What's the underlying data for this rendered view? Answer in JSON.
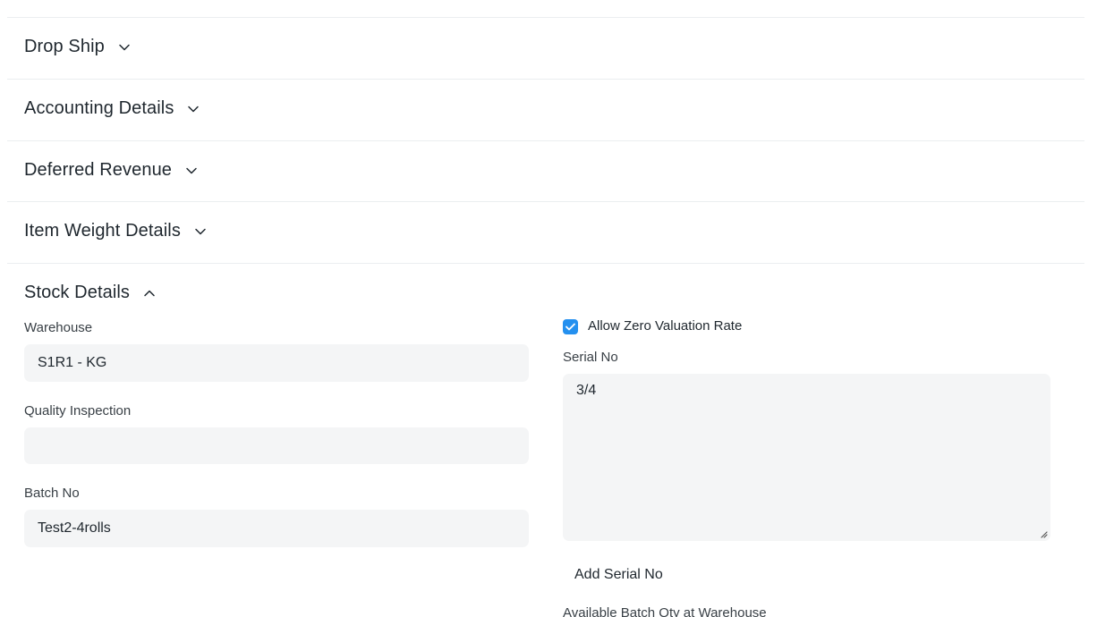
{
  "sections": {
    "drop_ship": "Drop Ship",
    "accounting_details": "Accounting Details",
    "deferred_revenue": "Deferred Revenue",
    "item_weight_details": "Item Weight Details",
    "stock_details": "Stock Details"
  },
  "stock": {
    "warehouse_label": "Warehouse",
    "warehouse_value": "S1R1 - KG",
    "quality_inspection_label": "Quality Inspection",
    "quality_inspection_value": "",
    "batch_no_label": "Batch No",
    "batch_no_value": "Test2-4rolls",
    "allow_zero_valuation_label": "Allow Zero Valuation Rate",
    "allow_zero_valuation_checked": true,
    "serial_no_label": "Serial No",
    "serial_no_value": "3/4",
    "add_serial_no_label": "Add Serial No",
    "available_batch_qty_label": "Available Batch Qty at Warehouse"
  },
  "colors": {
    "accent": "#2490ef",
    "input_bg": "#f4f5f6",
    "divider": "#ebeef0"
  }
}
